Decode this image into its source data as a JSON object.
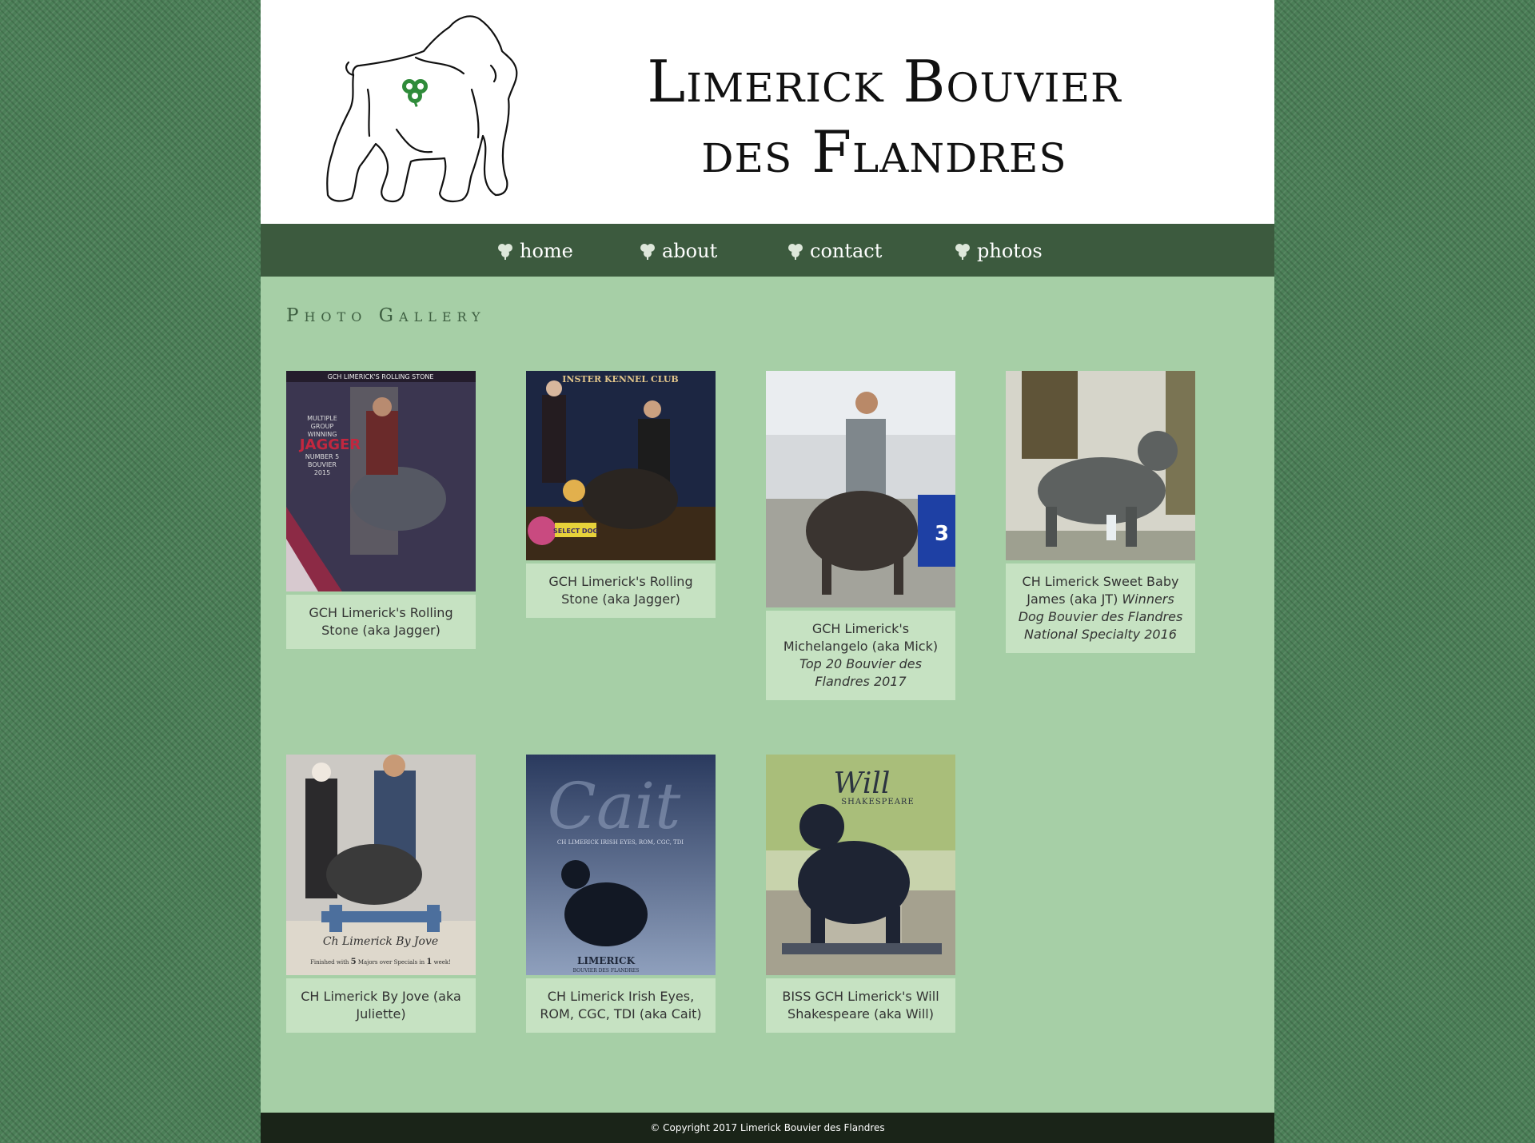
{
  "header": {
    "title": "Limerick Bouvier des Flandres"
  },
  "nav": {
    "items": [
      {
        "label": "home"
      },
      {
        "label": "about"
      },
      {
        "label": "contact"
      },
      {
        "label": "photos"
      }
    ]
  },
  "main": {
    "section_title": "Photo Gallery",
    "gallery": [
      {
        "caption": "GCH Limerick's Rolling Stone (aka Jagger)",
        "poster_top": "GCH LIMERICK'S ROLLING STONE",
        "poster_lines": [
          "MULTIPLE",
          "GROUP",
          "WINNING"
        ],
        "poster_name": "JAGGER",
        "poster_sub": [
          "NUMBER 5",
          "BOUVIER",
          "2015"
        ]
      },
      {
        "caption": "GCH Limerick's Rolling Stone (aka Jagger)",
        "banner": "INSTER KENNEL CLUB",
        "sign": "SELECT DOG"
      },
      {
        "caption": "GCH Limerick's Michelangelo (aka Mick)",
        "caption_em": "Top 20 Bouvier des Flandres 2017",
        "ring_number": "3"
      },
      {
        "caption": "CH Limerick Sweet Baby James (aka JT)",
        "caption_em": "Winners Dog Bouvier des Flandres National Specialty 2016"
      },
      {
        "caption": "CH Limerick By Jove (aka Juliette)",
        "poster_script": "Ch Limerick By Jove",
        "poster_note_pre": "Finished with ",
        "poster_note_num": "5",
        "poster_note_mid": " Majors over Specials in ",
        "poster_note_num2": "1",
        "poster_note_end": " week!"
      },
      {
        "caption": "CH Limerick Irish Eyes, ROM, CGC, TDI (aka Cait)",
        "poster_script": "Cait",
        "poster_sub": "CH LIMERICK IRISH EYES, ROM, CGC, TDI",
        "poster_brand": "LIMERICK",
        "poster_brand_sub": "BOUVIER DES FLANDRES"
      },
      {
        "caption": "BISS GCH Limerick's Will Shakespeare (aka Will)",
        "poster_script": "Will",
        "poster_sub": "SHAKESPEARE"
      }
    ]
  },
  "footer": {
    "copyright": "© Copyright 2017 Limerick Bouvier des Flandres"
  },
  "colors": {
    "background": "#4b7f57",
    "page": "#a6cfa6",
    "nav": "#3c5a3e",
    "caption_bg": "#c6e2c2",
    "footer": "#1a2418",
    "shamrock": "#2f8b3a"
  },
  "icons": [
    "shamrock-icon",
    "dog-logo-icon"
  ]
}
